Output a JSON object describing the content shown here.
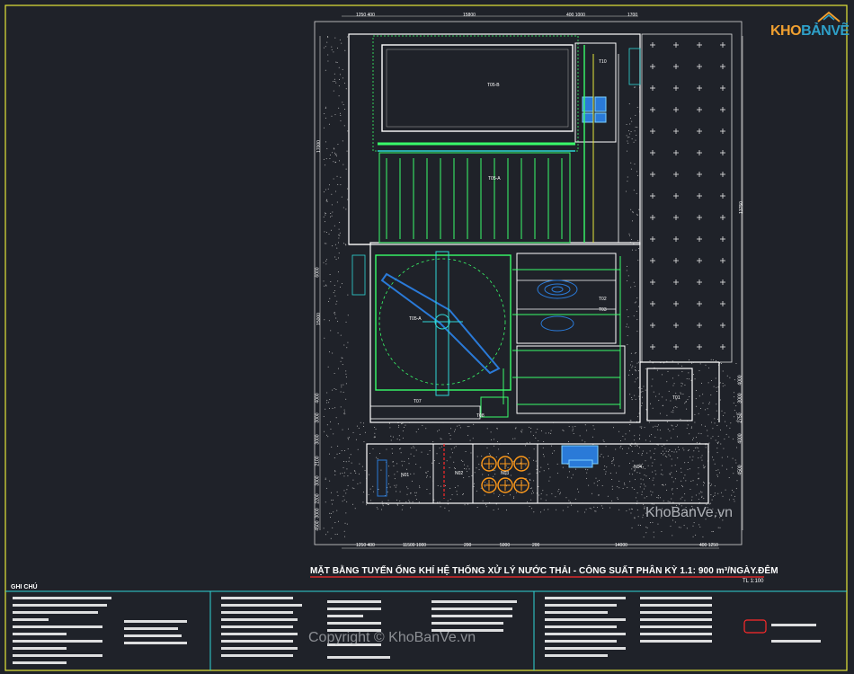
{
  "drawing": {
    "title": "MẶT BẰNG TUYẾN ỐNG KHÍ HỆ THỐNG XỬ LÝ NƯỚC THẢI - CÔNG SUẤT PHÂN KỲ 1.1: 900 m³/NGÀY.ĐÊM",
    "scale": "TL 1:100"
  },
  "notes": {
    "heading": "GHI CHÚ"
  },
  "tank_labels": {
    "t05b": "T05-B",
    "t05": "T05-A",
    "t05a": "T05-A",
    "t01": "T01",
    "t02": "T02",
    "t03": "T03",
    "t06": "T06",
    "t07": "T07",
    "t08": "T08",
    "t09": "T09",
    "t10": "T10",
    "n01": "N01",
    "n02": "N02",
    "n03": "N03",
    "n04": "N04"
  },
  "dimensions": {
    "top": [
      "1250 400",
      "15800",
      "400 1000",
      "1700"
    ],
    "bottom": [
      "1250 400",
      "11500 1000",
      "200",
      "5000",
      "200",
      "14000",
      "400 1250"
    ],
    "left": [
      "17000",
      "6000",
      "15000",
      "4000",
      "3000",
      "3000",
      "2100",
      "3000",
      "2200",
      "3000",
      "4500"
    ],
    "right": [
      "13750",
      "4000",
      "3000",
      "2750",
      "4000",
      "4500"
    ]
  },
  "brand": {
    "logo_text_a": "KHO",
    "logo_text_b": "BẢNVẼ",
    "watermark": "KhoBanVe.vn",
    "copyright": "Copyright © KhoBanVe.vn"
  },
  "colors": {
    "background": "#1f2229",
    "frame": "#e6e63a",
    "walls": "#ffffff",
    "pipe_green": "#39ff6a",
    "pipe_cyan": "#41e2e0",
    "equipment_blue": "#2f7bff",
    "equipment_orange": "#ff9a1a",
    "red_line": "#ff2a2a",
    "title_underline": "#ff2a2a"
  }
}
